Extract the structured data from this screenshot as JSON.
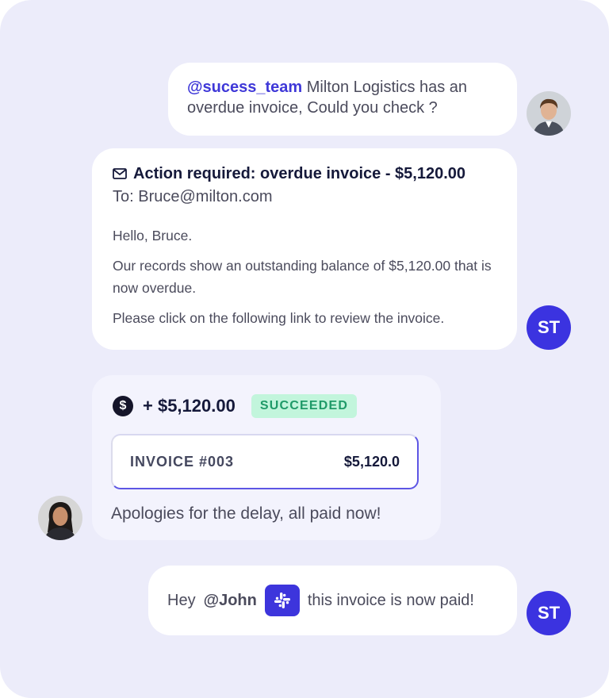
{
  "colors": {
    "background": "#ececfa",
    "accent": "#3b33e0",
    "success_bg": "#c2f5dc",
    "success_text": "#1f9a68"
  },
  "messages": {
    "first": {
      "mention": "@sucess_team",
      "text": "Milton Logistics has an overdue invoice, Could you check ?"
    },
    "email": {
      "icon": "mail-icon",
      "subject": "Action required: overdue invoice - $5,120.00",
      "to": "To: Bruce@milton.com",
      "greeting": "Hello, Bruce.",
      "body1": "Our records show an outstanding balance of $5,120.00 that is now overdue.",
      "body2": "Please click on the following link to review the invoice.",
      "avatar": "ST"
    },
    "payment": {
      "icon": "dollar-icon",
      "amount": "+ $5,120.00",
      "status": "SUCCEEDED",
      "invoice_title": "INVOICE #003",
      "invoice_amount": "$5,120.0",
      "message": "Apologies for the delay, all paid now!"
    },
    "last": {
      "prefix": "Hey",
      "mention": "@John",
      "icon": "slack-icon",
      "text": "this invoice is now paid!",
      "avatar": "ST"
    }
  }
}
